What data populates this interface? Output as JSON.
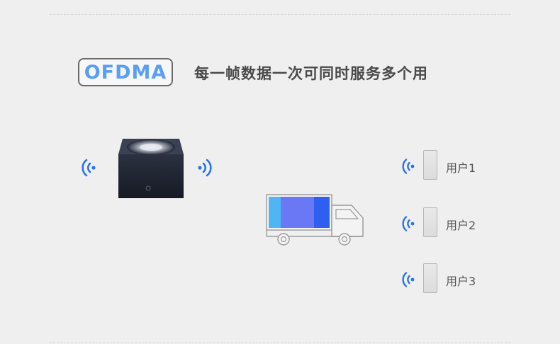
{
  "header": {
    "badge": "OFDMA",
    "headline": "每一帧数据一次可同时服务多个用"
  },
  "users": [
    {
      "label": "用户1"
    },
    {
      "label": "用户2"
    },
    {
      "label": "用户3"
    }
  ],
  "colors": {
    "wifi_blue": "#2a73e8",
    "badge_text": "#5a9ef6",
    "cargo_light_blue": "#4fb6f3",
    "cargo_violet": "#6b78f5",
    "cargo_blue": "#2f5ff0"
  },
  "icons": {
    "left_signal": "wifi-signal-left-icon",
    "right_signal": "wifi-signal-right-icon",
    "router": "router-device-icon",
    "truck": "delivery-truck-icon",
    "phone": "phone-icon"
  }
}
